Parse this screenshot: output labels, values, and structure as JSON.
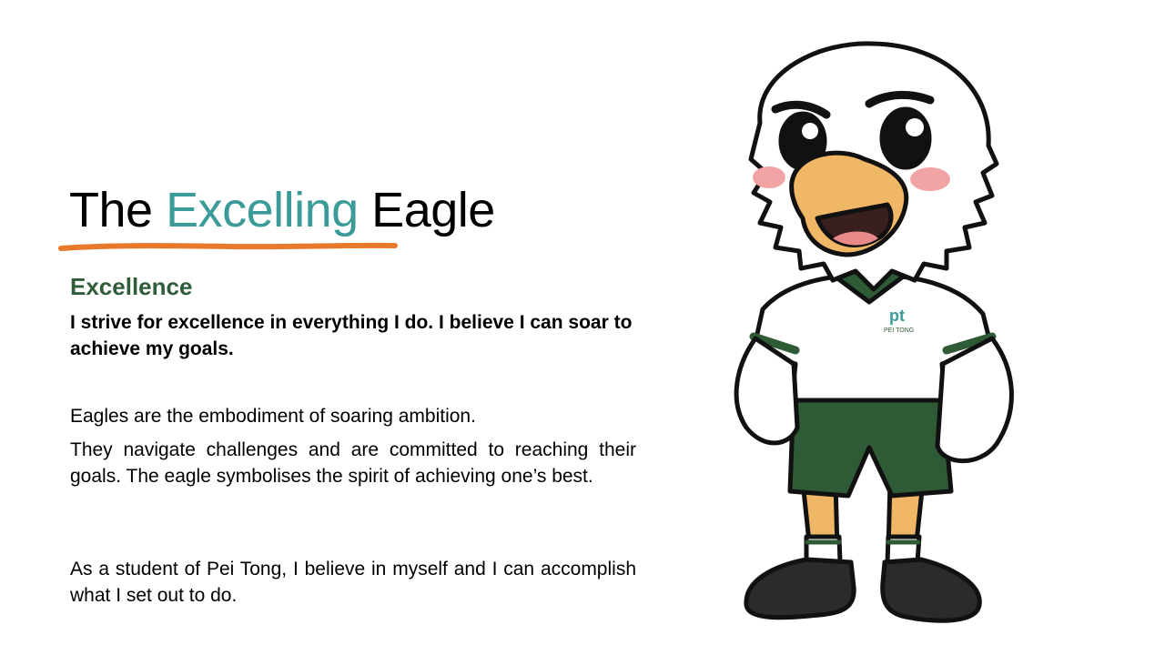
{
  "slide": {
    "title": {
      "word1": "The ",
      "accent": "Excelling",
      "word3": " Eagle"
    },
    "subheading": "Excellence",
    "lead": "I strive for excellence in everything I do. I believe I can soar to achieve my goals.",
    "paragraphs": [
      "Eagles are the embodiment of soaring ambition.",
      "They navigate challenges and are committed to reaching their goals. The eagle symbolises the spirit of achieving one’s best.",
      "As a student of Pei Tong, I believe in myself and I can accomplish what I set out to do."
    ],
    "mascot": {
      "logo_mark": "pt",
      "logo_text": "PEI TONG"
    },
    "colors": {
      "accent": "#3a9b98",
      "underline": "#e8792b",
      "subheading": "#2f5d3a",
      "shorts": "#2e5a36",
      "beak": "#f0b866"
    }
  }
}
